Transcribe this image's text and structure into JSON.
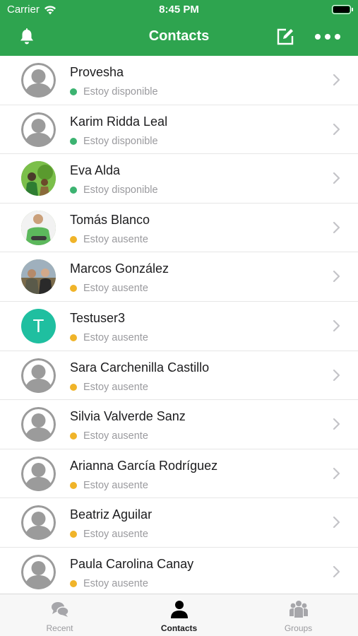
{
  "status_bar": {
    "carrier": "Carrier",
    "time": "8:45 PM"
  },
  "nav": {
    "title": "Contacts"
  },
  "colors": {
    "header": "#2ea44f",
    "available": "#3cb371",
    "away": "#f0b429",
    "avatar_letter_bg": "#1fbfa0"
  },
  "contacts": [
    {
      "name": "Provesha",
      "status": "Estoy disponible",
      "presence": "available",
      "avatar": "default"
    },
    {
      "name": "Karim Ridda Leal",
      "status": "Estoy disponible",
      "presence": "available",
      "avatar": "default"
    },
    {
      "name": "Eva Alda",
      "status": "Estoy disponible",
      "presence": "available",
      "avatar": "photo"
    },
    {
      "name": "Tomás Blanco",
      "status": "Estoy ausente",
      "presence": "away",
      "avatar": "photo"
    },
    {
      "name": "Marcos González",
      "status": "Estoy ausente",
      "presence": "away",
      "avatar": "photo"
    },
    {
      "name": "Testuser3",
      "status": "Estoy ausente",
      "presence": "away",
      "avatar": "letter",
      "initial": "T"
    },
    {
      "name": "Sara Carchenilla Castillo",
      "status": "Estoy ausente",
      "presence": "away",
      "avatar": "default"
    },
    {
      "name": "Silvia Valverde Sanz",
      "status": "Estoy ausente",
      "presence": "away",
      "avatar": "default"
    },
    {
      "name": "Arianna García Rodríguez",
      "status": "Estoy ausente",
      "presence": "away",
      "avatar": "default"
    },
    {
      "name": "Beatriz Aguilar",
      "status": "Estoy ausente",
      "presence": "away",
      "avatar": "default"
    },
    {
      "name": "Paula Carolina Canay",
      "status": "Estoy ausente",
      "presence": "away",
      "avatar": "default"
    }
  ],
  "tabs": [
    {
      "label": "Recent",
      "icon": "chat-bubbles-icon",
      "active": false
    },
    {
      "label": "Contacts",
      "icon": "person-icon",
      "active": true
    },
    {
      "label": "Groups",
      "icon": "group-icon",
      "active": false
    }
  ]
}
